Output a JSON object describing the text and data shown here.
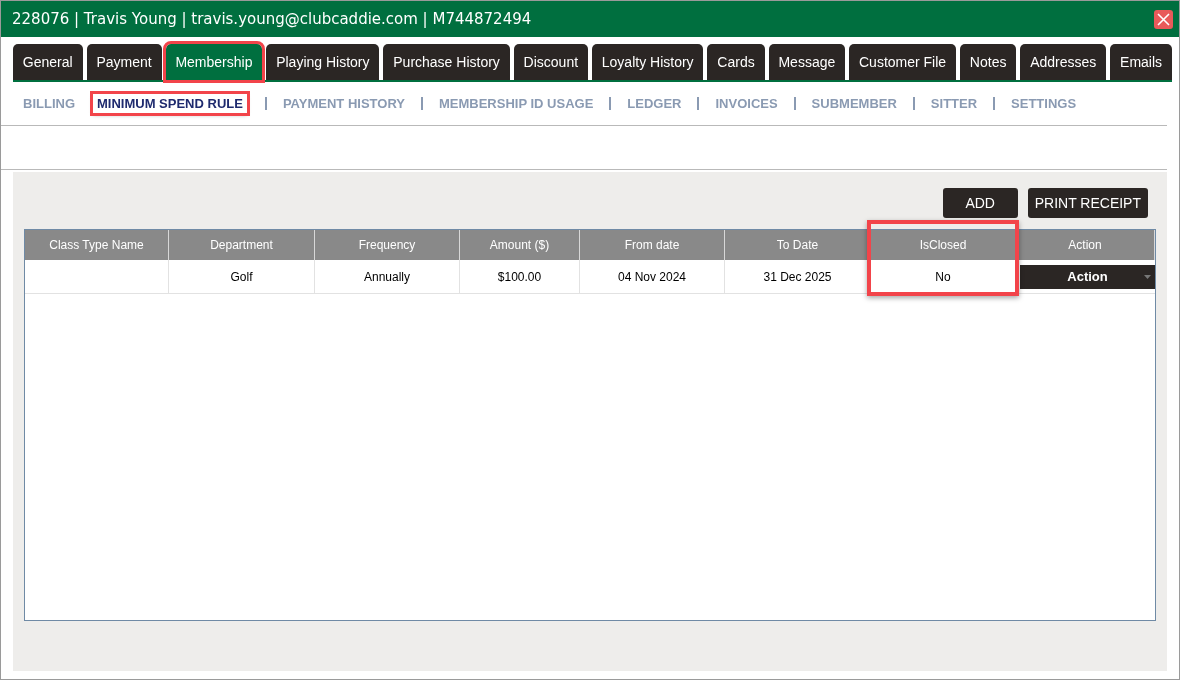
{
  "window": {
    "title": "228076 | Travis Young | travis.young@clubcaddie.com | M744872494"
  },
  "tabs": [
    {
      "label": "General",
      "selected": false,
      "highlighted": false
    },
    {
      "label": "Payment",
      "selected": false,
      "highlighted": false
    },
    {
      "label": "Membership",
      "selected": true,
      "highlighted": true
    },
    {
      "label": "Playing History",
      "selected": false,
      "highlighted": false
    },
    {
      "label": "Purchase History",
      "selected": false,
      "highlighted": false
    },
    {
      "label": "Discount",
      "selected": false,
      "highlighted": false
    },
    {
      "label": "Loyalty History",
      "selected": false,
      "highlighted": false
    },
    {
      "label": "Cards",
      "selected": false,
      "highlighted": false
    },
    {
      "label": "Message",
      "selected": false,
      "highlighted": false
    },
    {
      "label": "Customer File",
      "selected": false,
      "highlighted": false
    },
    {
      "label": "Notes",
      "selected": false,
      "highlighted": false
    },
    {
      "label": "Addresses",
      "selected": false,
      "highlighted": false
    },
    {
      "label": "Emails",
      "selected": false,
      "highlighted": false
    }
  ],
  "subtabs": [
    {
      "label": "BILLING",
      "selected": false,
      "highlighted": false
    },
    {
      "label": "MINIMUM SPEND RULE",
      "selected": true,
      "highlighted": true
    },
    {
      "label": "PAYMENT HISTORY",
      "selected": false,
      "highlighted": false
    },
    {
      "label": "MEMBERSHIP ID USAGE",
      "selected": false,
      "highlighted": false
    },
    {
      "label": "LEDGER",
      "selected": false,
      "highlighted": false
    },
    {
      "label": "INVOICES",
      "selected": false,
      "highlighted": false
    },
    {
      "label": "SUBMEMBER",
      "selected": false,
      "highlighted": false
    },
    {
      "label": "SITTER",
      "selected": false,
      "highlighted": false
    },
    {
      "label": "SETTINGS",
      "selected": false,
      "highlighted": false
    }
  ],
  "toolbar": {
    "buttons": [
      "ADD",
      "PRINT RECEIPT"
    ]
  },
  "table": {
    "columns": [
      {
        "label": "Class Type Name",
        "highlighted": false
      },
      {
        "label": "Department",
        "highlighted": false
      },
      {
        "label": "Frequency",
        "highlighted": false
      },
      {
        "label": "Amount ($)",
        "highlighted": false
      },
      {
        "label": "From date",
        "highlighted": false
      },
      {
        "label": "To Date",
        "highlighted": false
      },
      {
        "label": "IsClosed",
        "highlighted": true
      },
      {
        "label": "Action",
        "highlighted": false
      }
    ],
    "rows": [
      {
        "cells": [
          "",
          "Golf",
          "Annually",
          "$100.00",
          "04 Nov 2024",
          "31 Dec 2025",
          "No"
        ],
        "action": "Action"
      }
    ]
  }
}
